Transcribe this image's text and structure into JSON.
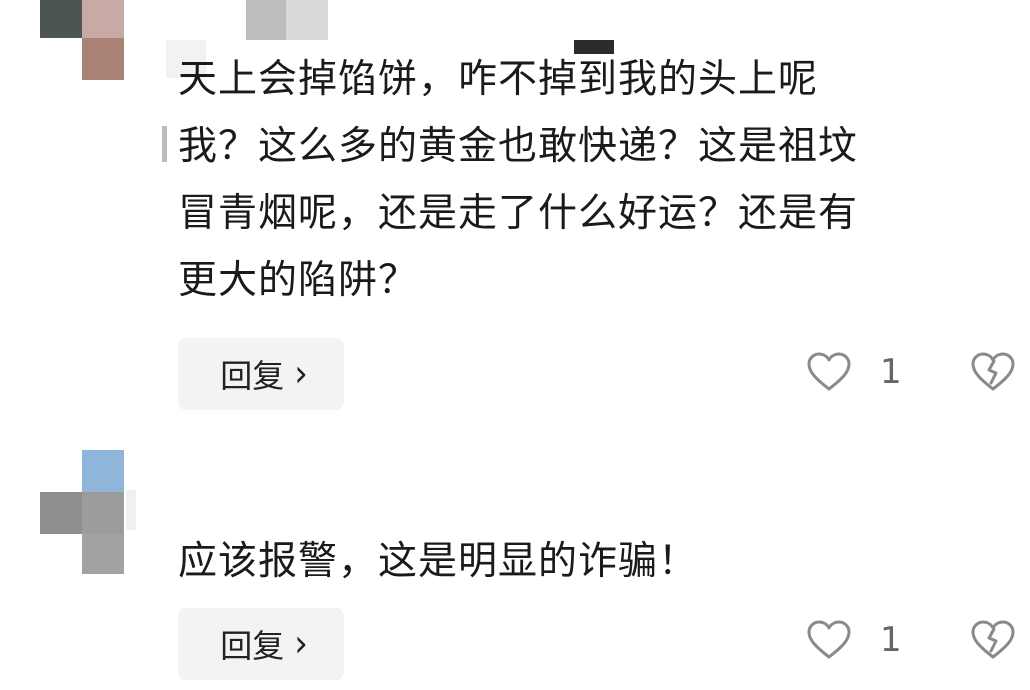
{
  "comments": [
    {
      "text": "天上会掉馅饼，咋不掉到我的头上呢\n我？这么多的黄金也敢快递？这是祖坟\n冒青烟呢，还是走了什么好运？还是有\n更大的陷阱？",
      "reply_label": "回复",
      "like_count": "1",
      "icons": {
        "like": "heart-outline-icon",
        "dislike": "broken-heart-icon",
        "reply_arrow": "chevron-right-icon"
      }
    },
    {
      "text": "应该报警，这是明显的诈骗！",
      "reply_label": "回复",
      "like_count": "1",
      "icons": {
        "like": "heart-outline-icon",
        "dislike": "broken-heart-icon",
        "reply_arrow": "chevron-right-icon"
      }
    }
  ],
  "colors": {
    "reply_bg": "#f2f3f5",
    "icon_gray": "#8a8a8a",
    "text": "#1a1a1a"
  }
}
